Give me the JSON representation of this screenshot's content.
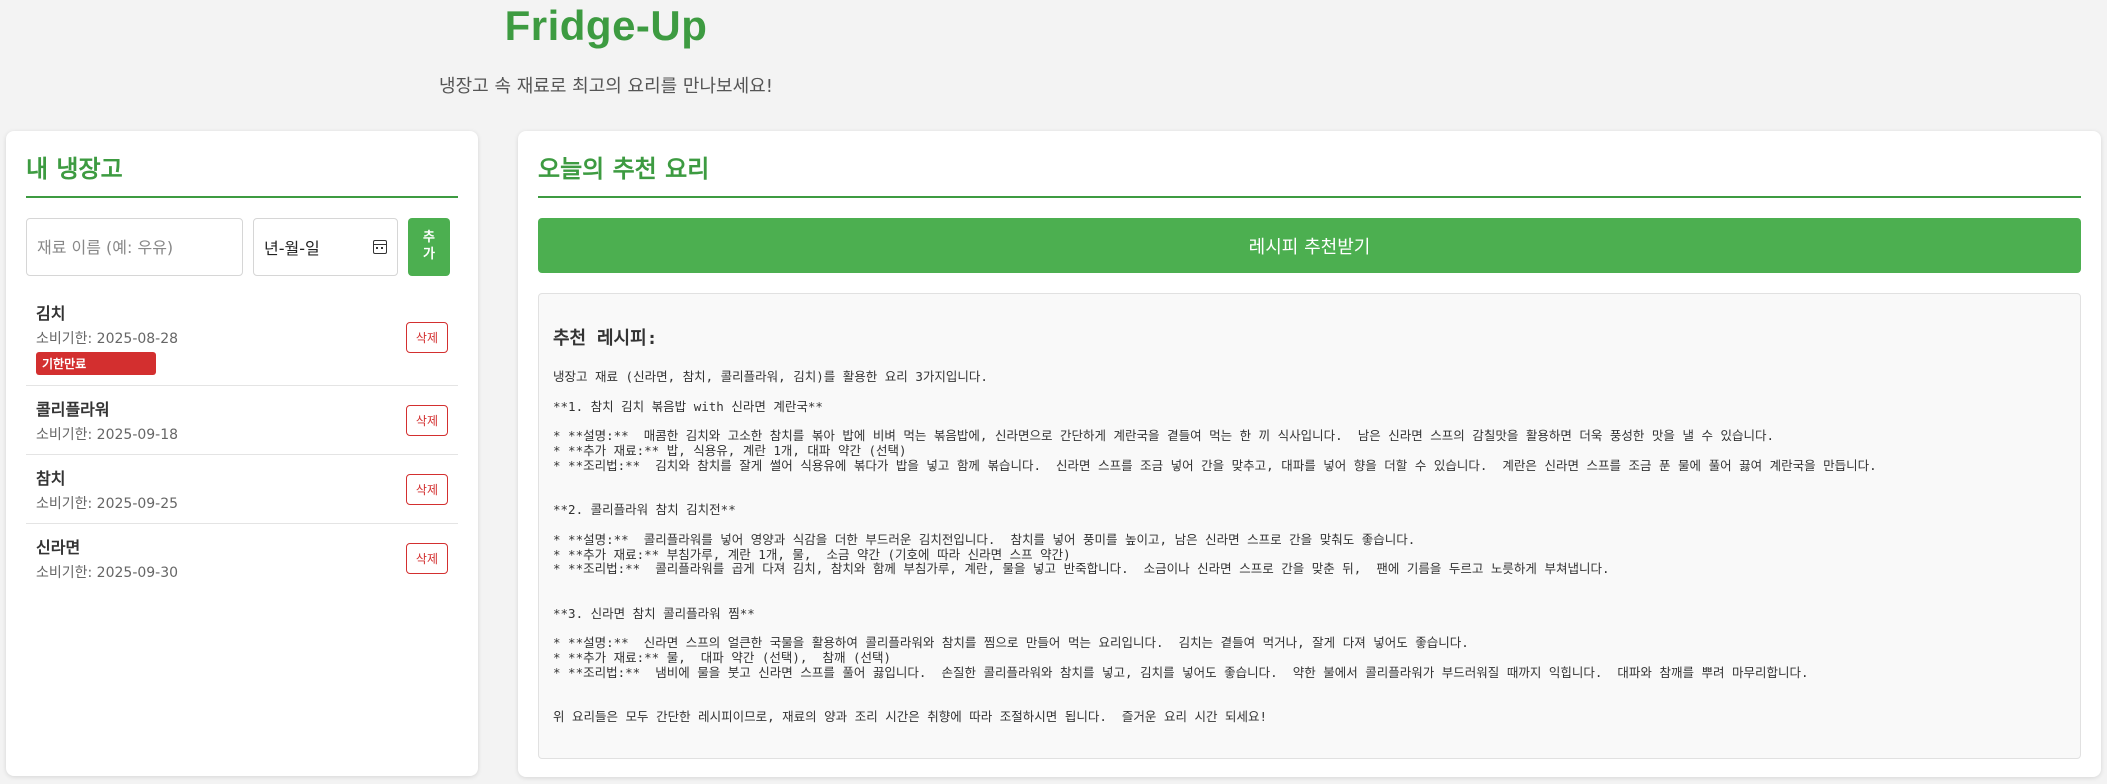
{
  "header": {
    "title": "Fridge-Up",
    "subtitle": "냉장고 속 재료로 최고의 요리를 만나보세요!"
  },
  "fridge": {
    "title": "내 냉장고",
    "name_placeholder": "재료 이름 (예: 우유)",
    "date_placeholder": "년-월-일",
    "add_label": "추가",
    "delete_label": "삭제",
    "expired_label": "기한만료",
    "items": [
      {
        "name": "김치",
        "expiry": "소비기한: 2025-08-28"
      },
      {
        "name": "콜리플라워",
        "expiry": "소비기한: 2025-09-18"
      },
      {
        "name": "참치",
        "expiry": "소비기한: 2025-09-25"
      },
      {
        "name": "신라면",
        "expiry": "소비기한: 2025-09-30"
      }
    ]
  },
  "recommend": {
    "title": "오늘의 추천 요리",
    "button_label": "레시피 추천받기",
    "recipe_heading": "추천 레시피:",
    "recipe_text": "냉장고 재료 (신라면, 참치, 콜리플라워, 김치)를 활용한 요리 3가지입니다.\n\n**1. 참치 김치 볶음밥 with 신라면 계란국**\n\n* **설명:**  매콤한 김치와 고소한 참치를 볶아 밥에 비벼 먹는 볶음밥에, 신라면으로 간단하게 계란국을 곁들여 먹는 한 끼 식사입니다.  남은 신라면 스프의 감칠맛을 활용하면 더욱 풍성한 맛을 낼 수 있습니다.\n* **추가 재료:** 밥, 식용유, 계란 1개, 대파 약간 (선택)\n* **조리법:**  김치와 참치를 잘게 썰어 식용유에 볶다가 밥을 넣고 함께 볶습니다.  신라면 스프를 조금 넣어 간을 맞추고, 대파를 넣어 향을 더할 수 있습니다.  계란은 신라면 스프를 조금 푼 물에 풀어 끓여 계란국을 만듭니다.\n\n\n**2. 콜리플라워 참치 김치전**\n\n* **설명:**  콜리플라워를 넣어 영양과 식감을 더한 부드러운 김치전입니다.  참치를 넣어 풍미를 높이고, 남은 신라면 스프로 간을 맞춰도 좋습니다.\n* **추가 재료:** 부침가루, 계란 1개, 물,  소금 약간 (기호에 따라 신라면 스프 약간)\n* **조리법:**  콜리플라워를 곱게 다져 김치, 참치와 함께 부침가루, 계란, 물을 넣고 반죽합니다.  소금이나 신라면 스프로 간을 맞춘 뒤,  팬에 기름을 두르고 노릇하게 부쳐냅니다.\n\n\n**3. 신라면 참치 콜리플라워 찜**\n\n* **설명:**  신라면 스프의 얼큰한 국물을 활용하여 콜리플라워와 참치를 찜으로 만들어 먹는 요리입니다.  김치는 곁들여 먹거나, 잘게 다져 넣어도 좋습니다.\n* **추가 재료:** 물,  대파 약간 (선택),  참깨 (선택)\n* **조리법:**  냄비에 물을 붓고 신라면 스프를 풀어 끓입니다.  손질한 콜리플라워와 참치를 넣고, 김치를 넣어도 좋습니다.  약한 불에서 콜리플라워가 부드러워질 때까지 익힙니다.  대파와 참깨를 뿌려 마무리합니다.\n\n\n위 요리들은 모두 간단한 레시피이므로, 재료의 양과 조리 시간은 취향에 따라 조절하시면 됩니다.  즐거운 요리 시간 되세요!"
  }
}
